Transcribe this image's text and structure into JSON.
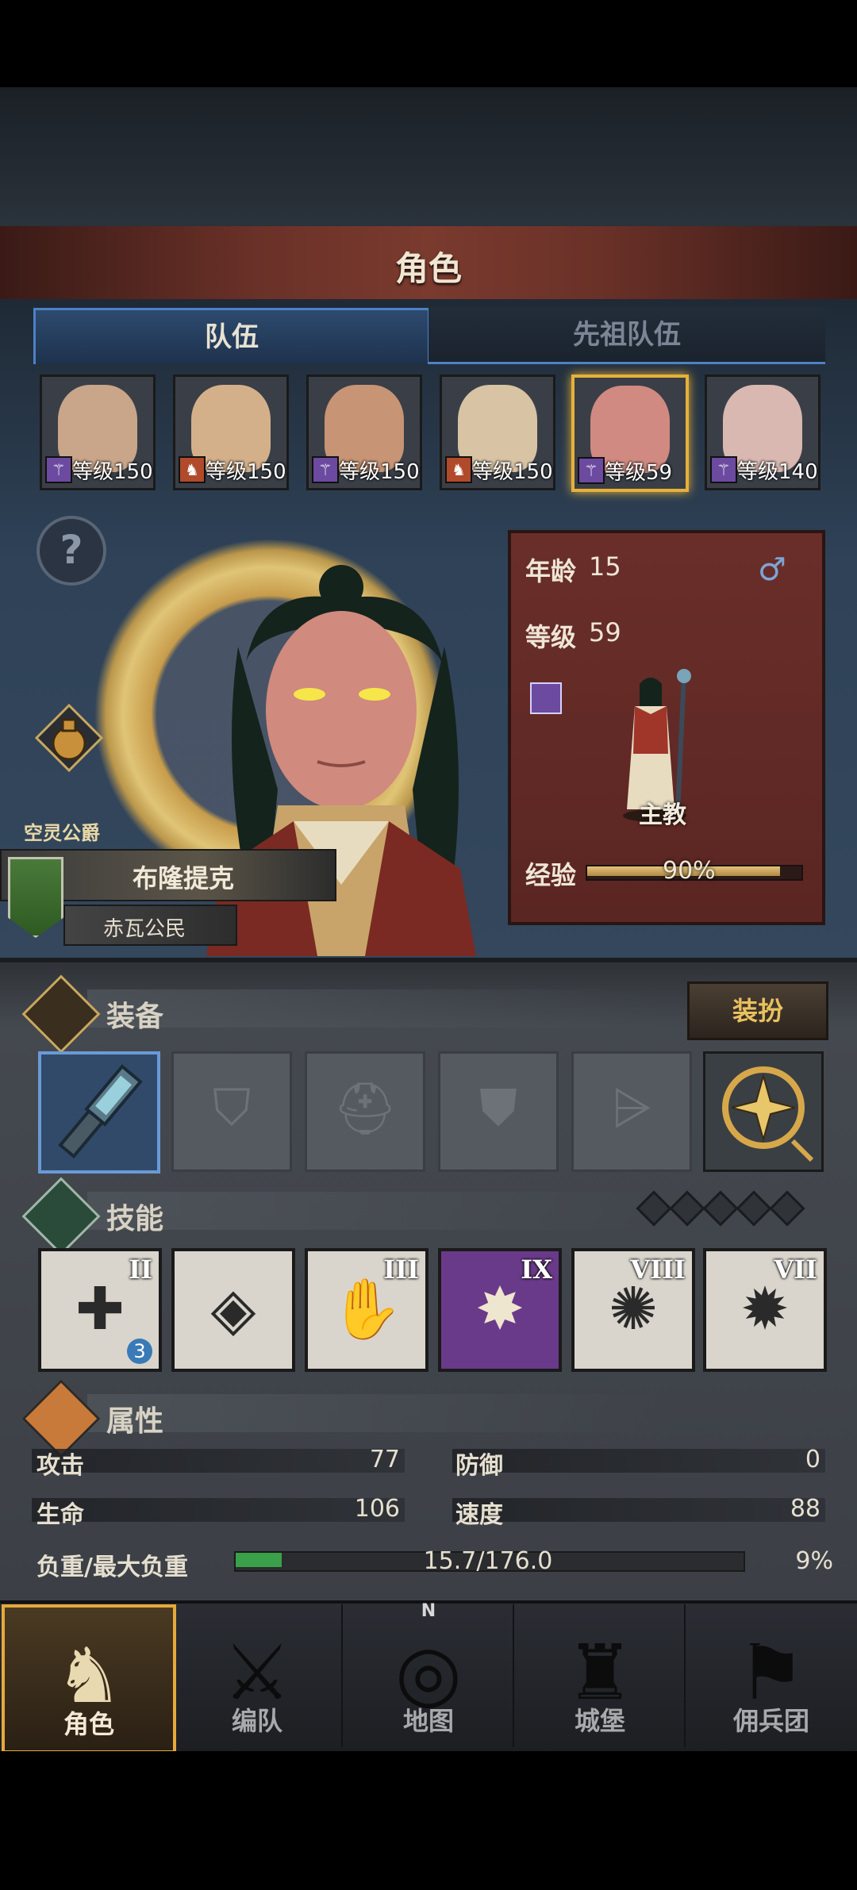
{
  "title": "角色",
  "tabs": {
    "team": "队伍",
    "ancestor": "先祖队伍"
  },
  "roster": [
    {
      "level": "等级150",
      "badge_color": "#6b4aa0",
      "face_color": "#c9a58a"
    },
    {
      "level": "等级150",
      "badge_color": "#b04a2a",
      "face_color": "#d4b08a"
    },
    {
      "level": "等级150",
      "badge_color": "#6b4aa0",
      "face_color": "#c79475"
    },
    {
      "level": "等级150",
      "badge_color": "#b04a2a",
      "face_color": "#d8c3a4"
    },
    {
      "level": "等级59",
      "badge_color": "#6b4aa0",
      "face_color": "#d08a82",
      "selected": true
    },
    {
      "level": "等级140",
      "badge_color": "#6b4aa0",
      "face_color": "#d8b8b0"
    }
  ],
  "character": {
    "rank_title": "空灵公爵",
    "name": "布隆提克",
    "origin": "赤瓦公民",
    "age_label": "年龄",
    "age": "15",
    "level_label": "等级",
    "level": "59",
    "class": "主教",
    "exp_label": "经验",
    "exp": "90%",
    "exp_fraction": 0.9
  },
  "equipment": {
    "title": "装备",
    "dress_button": "装扮",
    "slots": [
      "weapon-icon",
      "shield-icon",
      "helmet-icon",
      "armor-icon",
      "boots-icon",
      "amulet-icon"
    ]
  },
  "skills": {
    "title": "技能",
    "gems": 5,
    "items": [
      {
        "icon": "heal-cross-icon",
        "rank": "II",
        "count": "3"
      },
      {
        "icon": "crystal-shrine-icon",
        "rank": ""
      },
      {
        "icon": "blessing-hand-icon",
        "rank": "III"
      },
      {
        "icon": "burst-icon",
        "rank": "IX"
      },
      {
        "icon": "shatter-icon",
        "rank": "VIII"
      },
      {
        "icon": "explosion-icon",
        "rank": "VII"
      }
    ]
  },
  "attributes": {
    "title": "属性",
    "attack_label": "攻击",
    "attack": "77",
    "defense_label": "防御",
    "defense": "0",
    "hp_label": "生命",
    "hp": "106",
    "speed_label": "速度",
    "speed": "88",
    "load_label": "负重/最大负重",
    "load": "15.7/176.0",
    "load_pct": "9%",
    "load_fraction": 0.09
  },
  "nav": [
    {
      "label": "角色",
      "icon": "knight-icon",
      "active": true
    },
    {
      "label": "编队",
      "icon": "formation-icon"
    },
    {
      "label": "地图",
      "icon": "compass-map-icon",
      "compass_n": "N"
    },
    {
      "label": "城堡",
      "icon": "castle-icon"
    },
    {
      "label": "佣兵团",
      "icon": "mercenary-icon"
    }
  ]
}
